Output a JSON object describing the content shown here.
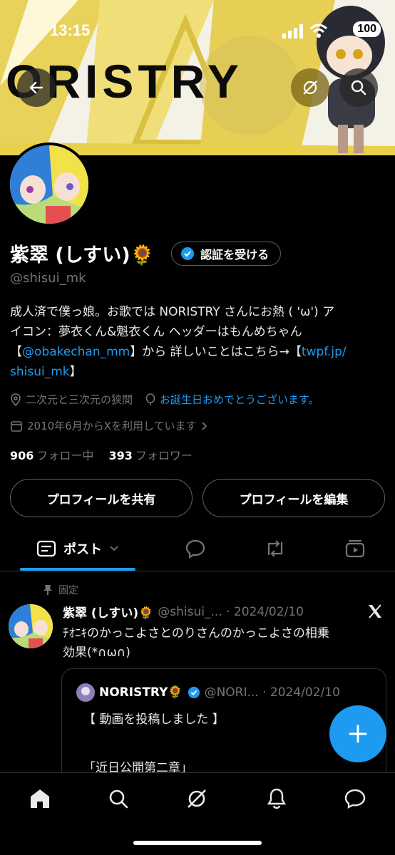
{
  "status_bar": {
    "time": "13:15",
    "battery": "100"
  },
  "banner": {
    "title": "ORISTRY"
  },
  "profile": {
    "display_name": "紫翠 (しすい)🌻",
    "verify_label": "認証を受ける",
    "handle": "@shisui_mk",
    "bio_line1": "成人済で僕っ娘。お歌では NORISTRY さんにお熱 ( 'ω') ア",
    "bio_line2": "イコン：夢衣くん&魁衣くん ヘッダーはもんめちゃん",
    "bio_line3_pre": "【",
    "bio_line3_link": "@obakechan_mm",
    "bio_line3_mid": "】から 詳しいことはこちら→【",
    "bio_line3_link2": "twpf.jp/",
    "bio_line4_link": "shisui_mk",
    "bio_line4_post": "】",
    "location": "二次元と三次元の狭間",
    "birthday": "お誕生日おめでとうございます。",
    "joined": "2010年6月からXを利用しています",
    "following_count": "906",
    "following_label": "フォロー中",
    "followers_count": "393",
    "followers_label": "フォロワー",
    "share_button": "プロフィールを共有",
    "edit_button": "プロフィールを編集"
  },
  "tabs": {
    "posts_label": "ポスト"
  },
  "pinned_tweet": {
    "pinned_label": "固定",
    "name": "紫翠 (しすい)🌻",
    "handle_date": "@shisui_... · 2024/02/10",
    "text_line1": "ﾁｵﾆｷのかっこよさとのりさんのかっこよさの相乗",
    "text_line2": "効果(*∩ω∩)",
    "quote": {
      "name": "NORISTRY🌻",
      "handle_date": "@NORI... · 2024/02/10",
      "text": "【 動画を投稿しました 】\n\n「近日公開第二章」\nPENGUIN RESEARCH @PQRsinfo"
    }
  },
  "colors": {
    "accent": "#1d9bf0",
    "background": "#000000",
    "muted": "#71767b"
  }
}
